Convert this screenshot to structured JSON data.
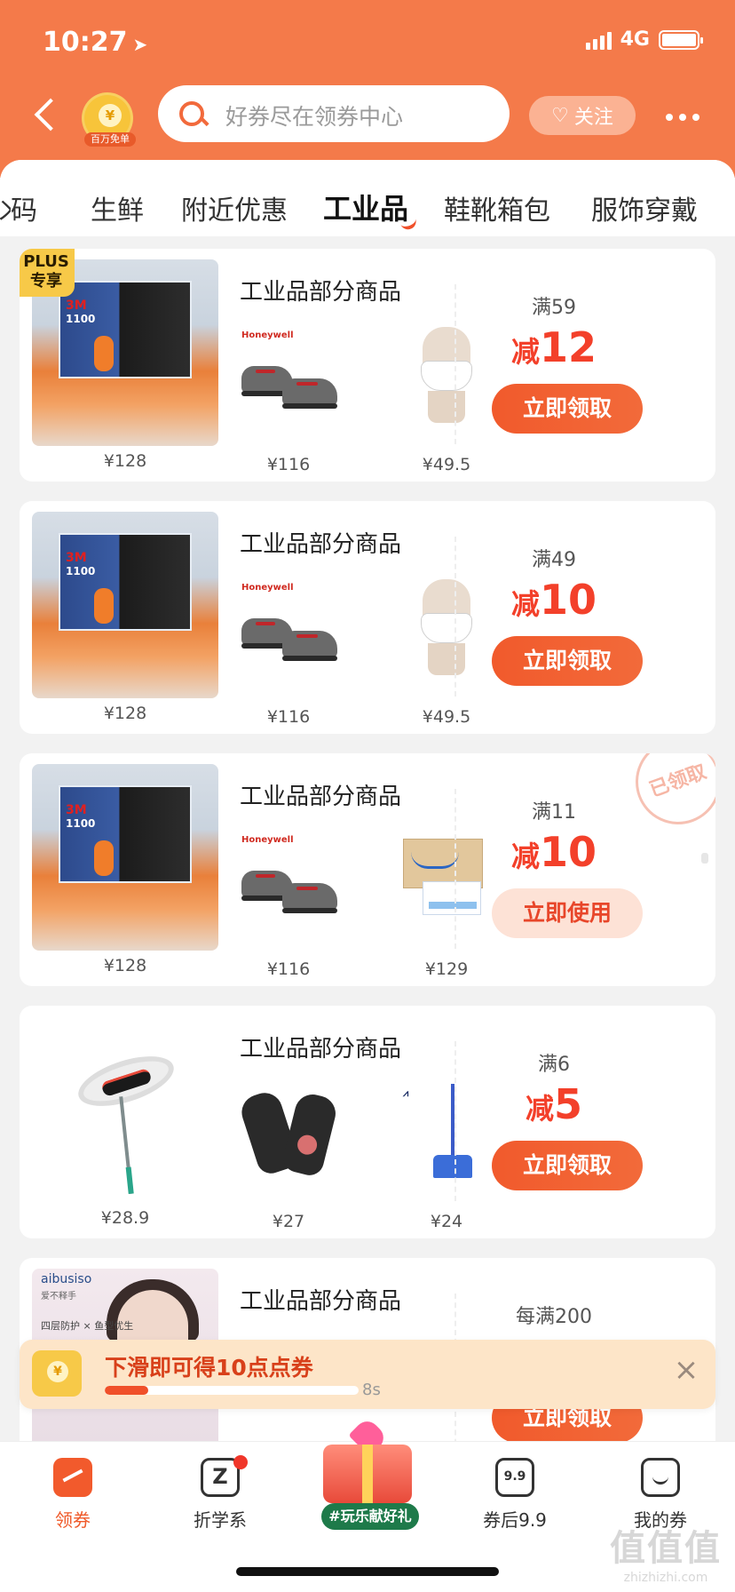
{
  "status_bar": {
    "time": "10:27",
    "network": "4G"
  },
  "header": {
    "badge_text": "百万免单",
    "search_placeholder": "好券尽在领券中心",
    "follow_label": "关注"
  },
  "tabs": [
    {
      "label": "码",
      "active": false
    },
    {
      "label": "生鲜",
      "active": false
    },
    {
      "label": "附近优惠",
      "active": false
    },
    {
      "label": "工业品",
      "active": true
    },
    {
      "label": "鞋靴箱包",
      "active": false
    },
    {
      "label": "服饰穿戴",
      "active": false
    }
  ],
  "cards": [
    {
      "plus_badge": [
        "PLUS",
        "专享"
      ],
      "main_price": "¥128",
      "title": "工业品部分商品",
      "items": [
        {
          "name": "shoes",
          "price": "¥116"
        },
        {
          "name": "mask",
          "price": "¥49.5"
        }
      ],
      "condition": "满59",
      "prefix": "减",
      "amount": "12",
      "button": "立即领取"
    },
    {
      "main_price": "¥128",
      "title": "工业品部分商品",
      "items": [
        {
          "name": "shoes",
          "price": "¥116"
        },
        {
          "name": "mask",
          "price": "¥49.5"
        }
      ],
      "condition": "满49",
      "prefix": "减",
      "amount": "10",
      "button": "立即领取"
    },
    {
      "main_price": "¥128",
      "title": "工业品部分商品",
      "items": [
        {
          "name": "shoes",
          "price": "¥116"
        },
        {
          "name": "tissue",
          "price": "¥129"
        }
      ],
      "condition": "满11",
      "prefix": "减",
      "amount": "10",
      "button": "立即使用",
      "stamp": "已领取"
    },
    {
      "main_price": "¥28.9",
      "title": "工业品部分商品",
      "items": [
        {
          "name": "gloves",
          "price": "¥27"
        },
        {
          "name": "mop",
          "price": "¥24"
        }
      ],
      "condition": "满6",
      "prefix": "减",
      "amount": "5",
      "button": "立即领取"
    },
    {
      "main_brand": "aibusiso",
      "main_brand_sub": "爱不释手",
      "main_slogan": "四层防护 × 鱼型优生",
      "title": "工业品部分商品",
      "condition": "每满200",
      "button": "立即领取"
    }
  ],
  "toast": {
    "message": "下滑即可得10点点券",
    "seconds": "8s",
    "progress": 0.17
  },
  "tabbar": {
    "items": [
      {
        "label": "领券",
        "active": true
      },
      {
        "label": "折学系",
        "active": false
      },
      {
        "label": "券后9.9",
        "active": false
      },
      {
        "label": "我的券",
        "active": false
      }
    ],
    "promo_label": "#玩乐献好礼"
  },
  "watermark": {
    "big": "值值值",
    "small": "zhizhizhi.com"
  },
  "colors": {
    "header": "#f47a4a",
    "accent": "#f3402a",
    "plus_gold": "#f7c948"
  }
}
